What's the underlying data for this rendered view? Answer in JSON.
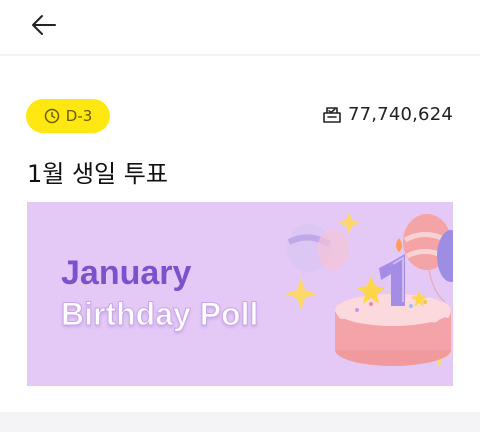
{
  "header": {
    "back_icon": "arrow-left-icon"
  },
  "poll": {
    "badge_icon": "clock-icon",
    "dday": "D-3",
    "vote_icon": "ballot-box-icon",
    "vote_count": "77,740,624",
    "title": "1월 생일 투표"
  },
  "banner": {
    "line1": "January",
    "line2": "Birthday Poll",
    "art": "birthday-cake-balloons-illustration",
    "colors": {
      "background": "#E4C9F7",
      "accent": "#7a52cc"
    }
  },
  "colors": {
    "badge": "#FFE812"
  }
}
